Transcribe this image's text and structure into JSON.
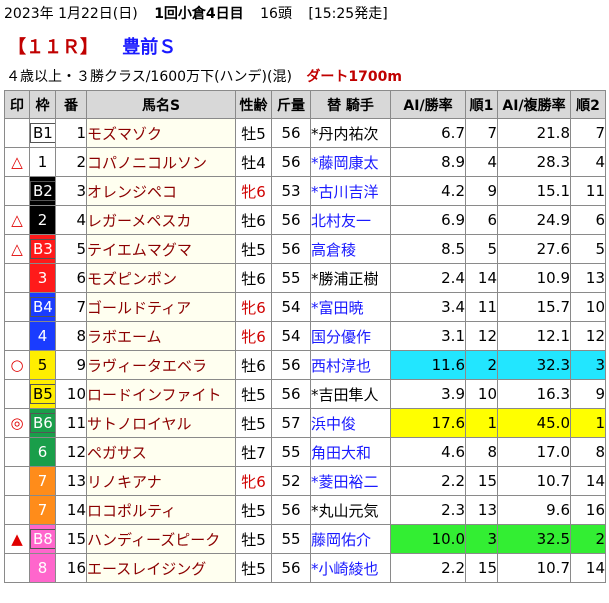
{
  "header": {
    "date": "2023年 1月22日(日)",
    "meeting": "1回小倉4日目",
    "runners": "16頭",
    "post_time": "[15:25発走]",
    "race_no": "【１１Ｒ】",
    "race_name": "豊前Ｓ",
    "conditions": "４歳以上・３勝クラス/1600万下(ハンデ)(混)",
    "course": "ダート1700m"
  },
  "columns": [
    "印",
    "枠",
    "番",
    "馬名S",
    "性齢",
    "斤量",
    "替 騎手",
    "AI/勝率",
    "順1",
    "AI/複勝率",
    "順2"
  ],
  "colors": {
    "frame_1": "#ffffff",
    "frame_2": "#000000",
    "frame_3": "#ff1a1a",
    "frame_4": "#1a3cff",
    "frame_5": "#ffee00",
    "frame_6": "#1a9e4a",
    "frame_7": "#ff8c1a",
    "frame_8": "#ff66cc",
    "highlight_cyan": "#22e6ff",
    "highlight_yellow": "#ffff00",
    "highlight_green": "#33ee33",
    "mark_red": "#e00000",
    "female_red": "#d00000",
    "horse_name": "#8b0000",
    "jockey_change_blue": "#1a1aff"
  },
  "horses": [
    {
      "mark": "",
      "frame": "B1",
      "frame_no": 1,
      "num": "1",
      "name": "モズマゾク",
      "sa": "牡5",
      "female": false,
      "kin": "56",
      "jockey": "*丹内祐次",
      "jockey_changed": false,
      "win": "6.7",
      "win_rank": "7",
      "place": "21.8",
      "place_rank": "7",
      "hl": ""
    },
    {
      "mark": "△",
      "frame": "1",
      "frame_no": 1,
      "num": "2",
      "name": "コパノニコルソン",
      "sa": "牡4",
      "female": false,
      "kin": "56",
      "jockey": "*藤岡康太",
      "jockey_changed": true,
      "win": "8.9",
      "win_rank": "4",
      "place": "28.3",
      "place_rank": "4",
      "hl": ""
    },
    {
      "mark": "",
      "frame": "B2",
      "frame_no": 2,
      "num": "3",
      "name": "オレンジペコ",
      "sa": "牝6",
      "female": true,
      "kin": "53",
      "jockey": "*古川吉洋",
      "jockey_changed": true,
      "win": "4.2",
      "win_rank": "9",
      "place": "15.1",
      "place_rank": "11",
      "hl": ""
    },
    {
      "mark": "△",
      "frame": "2",
      "frame_no": 2,
      "num": "4",
      "name": "レガーメペスカ",
      "sa": "牡6",
      "female": false,
      "kin": "56",
      "jockey": "北村友一",
      "jockey_changed": true,
      "win": "6.9",
      "win_rank": "6",
      "place": "24.9",
      "place_rank": "6",
      "hl": ""
    },
    {
      "mark": "△",
      "frame": "B3",
      "frame_no": 3,
      "num": "5",
      "name": "テイエムマグマ",
      "sa": "牡5",
      "female": false,
      "kin": "56",
      "jockey": "高倉稜",
      "jockey_changed": true,
      "win": "8.5",
      "win_rank": "5",
      "place": "27.6",
      "place_rank": "5",
      "hl": ""
    },
    {
      "mark": "",
      "frame": "3",
      "frame_no": 3,
      "num": "6",
      "name": "モズピンポン",
      "sa": "牡6",
      "female": false,
      "kin": "55",
      "jockey": "*勝浦正樹",
      "jockey_changed": false,
      "win": "2.4",
      "win_rank": "14",
      "place": "10.9",
      "place_rank": "13",
      "hl": ""
    },
    {
      "mark": "",
      "frame": "B4",
      "frame_no": 4,
      "num": "7",
      "name": "ゴールドティア",
      "sa": "牝6",
      "female": true,
      "kin": "54",
      "jockey": "*富田暁",
      "jockey_changed": true,
      "win": "3.4",
      "win_rank": "11",
      "place": "15.7",
      "place_rank": "10",
      "hl": ""
    },
    {
      "mark": "",
      "frame": "4",
      "frame_no": 4,
      "num": "8",
      "name": "ラボエーム",
      "sa": "牝6",
      "female": true,
      "kin": "54",
      "jockey": "国分優作",
      "jockey_changed": true,
      "win": "3.1",
      "win_rank": "12",
      "place": "12.1",
      "place_rank": "12",
      "hl": ""
    },
    {
      "mark": "○",
      "frame": "5",
      "frame_no": 5,
      "num": "9",
      "name": "ラヴィータエベラ",
      "sa": "牡6",
      "female": false,
      "kin": "56",
      "jockey": "西村淳也",
      "jockey_changed": true,
      "win": "11.6",
      "win_rank": "2",
      "place": "32.3",
      "place_rank": "3",
      "hl": "cyan"
    },
    {
      "mark": "",
      "frame": "B5",
      "frame_no": 5,
      "num": "10",
      "name": "ロードインファイト",
      "sa": "牡5",
      "female": false,
      "kin": "56",
      "jockey": "*吉田隼人",
      "jockey_changed": false,
      "win": "3.9",
      "win_rank": "10",
      "place": "16.3",
      "place_rank": "9",
      "hl": ""
    },
    {
      "mark": "◎",
      "frame": "B6",
      "frame_no": 6,
      "num": "11",
      "name": "サトノロイヤル",
      "sa": "牡5",
      "female": false,
      "kin": "57",
      "jockey": "浜中俊",
      "jockey_changed": true,
      "win": "17.6",
      "win_rank": "1",
      "place": "45.0",
      "place_rank": "1",
      "hl": "yellow"
    },
    {
      "mark": "",
      "frame": "6",
      "frame_no": 6,
      "num": "12",
      "name": "ペガサス",
      "sa": "牡7",
      "female": false,
      "kin": "55",
      "jockey": "角田大和",
      "jockey_changed": true,
      "win": "4.6",
      "win_rank": "8",
      "place": "17.0",
      "place_rank": "8",
      "hl": ""
    },
    {
      "mark": "",
      "frame": "7",
      "frame_no": 7,
      "num": "13",
      "name": "リノキアナ",
      "sa": "牝6",
      "female": true,
      "kin": "52",
      "jockey": "*菱田裕二",
      "jockey_changed": true,
      "win": "2.2",
      "win_rank": "15",
      "place": "10.7",
      "place_rank": "14",
      "hl": ""
    },
    {
      "mark": "",
      "frame": "7",
      "frame_no": 7,
      "num": "14",
      "name": "ロコポルティ",
      "sa": "牡5",
      "female": false,
      "kin": "56",
      "jockey": "*丸山元気",
      "jockey_changed": false,
      "win": "2.3",
      "win_rank": "13",
      "place": "9.6",
      "place_rank": "16",
      "hl": ""
    },
    {
      "mark": "▲",
      "frame": "B8",
      "frame_no": 8,
      "num": "15",
      "name": "ハンディーズピーク",
      "sa": "牡5",
      "female": false,
      "kin": "55",
      "jockey": "藤岡佑介",
      "jockey_changed": true,
      "win": "10.0",
      "win_rank": "3",
      "place": "32.5",
      "place_rank": "2",
      "hl": "green"
    },
    {
      "mark": "",
      "frame": "8",
      "frame_no": 8,
      "num": "16",
      "name": "エースレイジング",
      "sa": "牡5",
      "female": false,
      "kin": "56",
      "jockey": "*小崎綾也",
      "jockey_changed": true,
      "win": "2.2",
      "win_rank": "15",
      "place": "10.7",
      "place_rank": "14",
      "hl": ""
    }
  ]
}
